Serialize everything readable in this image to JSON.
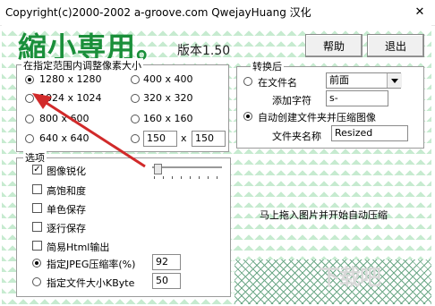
{
  "window": {
    "title": "Copyright(c)2000-2002 a-groove.com QwejayHuang 汉化",
    "close_glyph": "✕"
  },
  "header": {
    "app_name": "縮小専用。",
    "version": "版本1.50"
  },
  "buttons": {
    "help": "帮助",
    "exit": "退出"
  },
  "size_group": {
    "label": "在指定范围内调整像素大小",
    "options": [
      "1280 x 1280",
      "400 x 400",
      "1024 x 1024",
      "320 x 320",
      "800 x 600",
      "160 x 160",
      "640 x 640"
    ],
    "selected": "1280 x 1280",
    "custom_width": "150",
    "custom_x": "x",
    "custom_height": "150"
  },
  "convert_group": {
    "label": "转换后",
    "prefix_option": "在文件名",
    "position_value": "前面",
    "add_char_label": "添加字符",
    "add_char_value": "s-",
    "folder_option": "自动创建文件夹并压缩图像",
    "folder_name_label": "文件夹名称",
    "folder_name_value": "Resized",
    "selected": "自动创建文件夹并压缩图像"
  },
  "options_group": {
    "label": "选项",
    "sharpen": {
      "label": "图像锐化",
      "checked": true
    },
    "saturation": {
      "label": "高饱和度",
      "checked": false
    },
    "mono": {
      "label": "单色保存",
      "checked": false
    },
    "progressive": {
      "label": "逐行保存",
      "checked": false
    },
    "html": {
      "label": "简易Html输出",
      "checked": false
    },
    "jpeg_quality_label": "指定JPEG压缩率(%)",
    "jpeg_quality_value": "92",
    "file_size_label": "指定文件大小KByte",
    "file_size_value": "50",
    "selected": "指定JPEG压缩率(%)"
  },
  "drop_hint": "马上拖入图片并开始自动压缩",
  "watermark": "下载吧",
  "colors": {
    "title_green": "#1a8f3a",
    "pattern_green": "#82d296",
    "arrow_red": "#d12a2a"
  }
}
